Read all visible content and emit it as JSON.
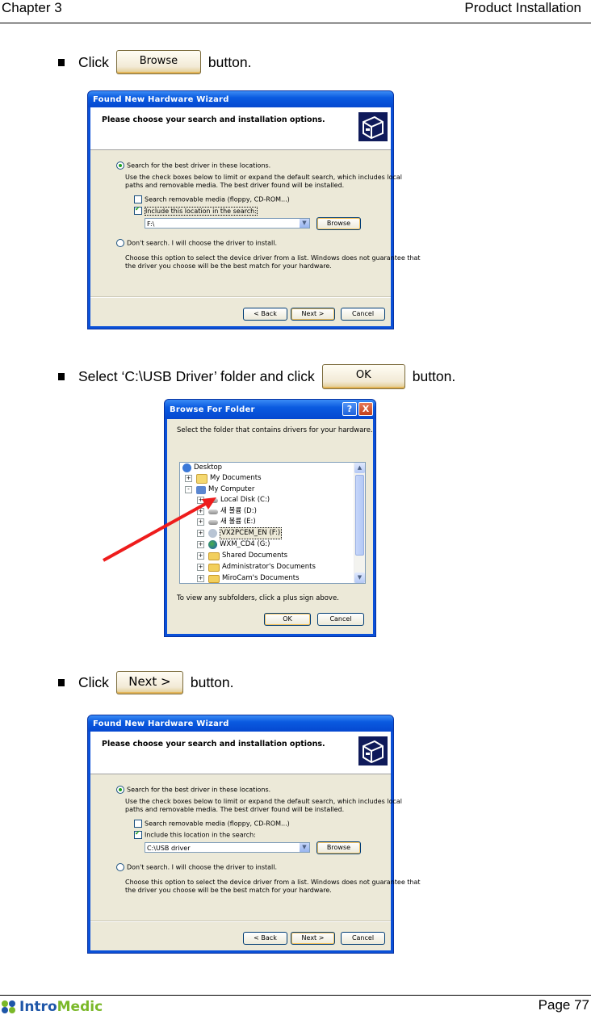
{
  "header": {
    "chapter": "Chapter 3",
    "section": "Product Installation"
  },
  "steps": [
    {
      "prefix": "Click",
      "button_label": "Browse",
      "suffix": "button."
    },
    {
      "prefix": "Select ‘C:\\USB Driver’ folder and click",
      "button_label": "OK",
      "suffix": "button."
    },
    {
      "prefix": "Click",
      "button_label": "Next >",
      "suffix": "button."
    }
  ],
  "wizard1": {
    "title": "Found New Hardware Wizard",
    "heading": "Please choose your search and installation options.",
    "radio_search": "Search for the best driver in these locations.",
    "search_desc_1": "Use the check boxes below to limit or expand the default search, which includes local",
    "search_desc_2": "paths and removable media. The best driver found will be installed.",
    "chk_removable": "Search removable media (floppy, CD-ROM...)",
    "chk_include": "Include this location in the search:",
    "location_value": "F:\\",
    "browse_label": "Browse",
    "radio_dont": "Don't search. I will choose the driver to install.",
    "dont_desc_1": "Choose this option to select the device driver from a list.  Windows does not guarantee that",
    "dont_desc_2": "the driver you choose will be the best match for your hardware.",
    "back_label": "< Back",
    "next_label": "Next >",
    "cancel_label": "Cancel"
  },
  "browse_folder": {
    "title": "Browse For Folder",
    "help_icon": "?",
    "close_icon": "X",
    "instruction": "Select the folder that contains drivers for your hardware.",
    "tree": [
      {
        "label": "Desktop",
        "icon": "desktop-icon",
        "level": 0,
        "expander": ""
      },
      {
        "label": "My Documents",
        "icon": "my-documents-icon",
        "level": 1,
        "expander": "+"
      },
      {
        "label": "My Computer",
        "icon": "my-computer-icon",
        "level": 1,
        "expander": "-"
      },
      {
        "label": "Local Disk (C:)",
        "icon": "disk-icon",
        "level": 2,
        "expander": "+"
      },
      {
        "label": "새 볼륨 (D:)",
        "icon": "disk-icon",
        "level": 2,
        "expander": "+"
      },
      {
        "label": "새 볼륨 (E:)",
        "icon": "disk-icon",
        "level": 2,
        "expander": "+"
      },
      {
        "label": "VX2PCEM_EN (F:)",
        "icon": "cd-drive-icon",
        "level": 2,
        "expander": "+",
        "selected": true
      },
      {
        "label": "WXM_CD4 (G:)",
        "icon": "network-drive-icon",
        "level": 2,
        "expander": "+"
      },
      {
        "label": "Shared Documents",
        "icon": "folder-icon",
        "level": 2,
        "expander": "+"
      },
      {
        "label": "Administrator's Documents",
        "icon": "folder-icon",
        "level": 2,
        "expander": "+"
      },
      {
        "label": "MiroCam's Documents",
        "icon": "folder-icon",
        "level": 2,
        "expander": "+"
      }
    ],
    "hint": "To view any subfolders, click a plus sign above.",
    "ok_label": "OK",
    "cancel_label": "Cancel"
  },
  "wizard2": {
    "title": "Found New Hardware Wizard",
    "heading": "Please choose your search and installation options.",
    "radio_search": "Search for the best driver in these locations.",
    "search_desc_1": "Use the check boxes below to limit or expand the default search, which includes local",
    "search_desc_2": "paths and removable media. The best driver found will be installed.",
    "chk_removable": "Search removable media (floppy, CD-ROM...)",
    "chk_include": "Include this location in the search:",
    "location_value": "C:\\USB driver",
    "browse_label": "Browse",
    "radio_dont": "Don't search. I will choose the driver to install.",
    "dont_desc_1": "Choose this option to select the device driver from a list.  Windows does not guarantee that",
    "dont_desc_2": "the driver you choose will be the best match for your hardware.",
    "back_label": "< Back",
    "next_label": "Next >",
    "cancel_label": "Cancel"
  },
  "footer": {
    "logo_intro": "Intro",
    "logo_medic": "Medic",
    "page": "Page 77"
  },
  "colors": {
    "annotation_arrow": "#ee1c1c",
    "xp_title_blue": "#0a50d8",
    "dialog_bg": "#ece9d8"
  }
}
